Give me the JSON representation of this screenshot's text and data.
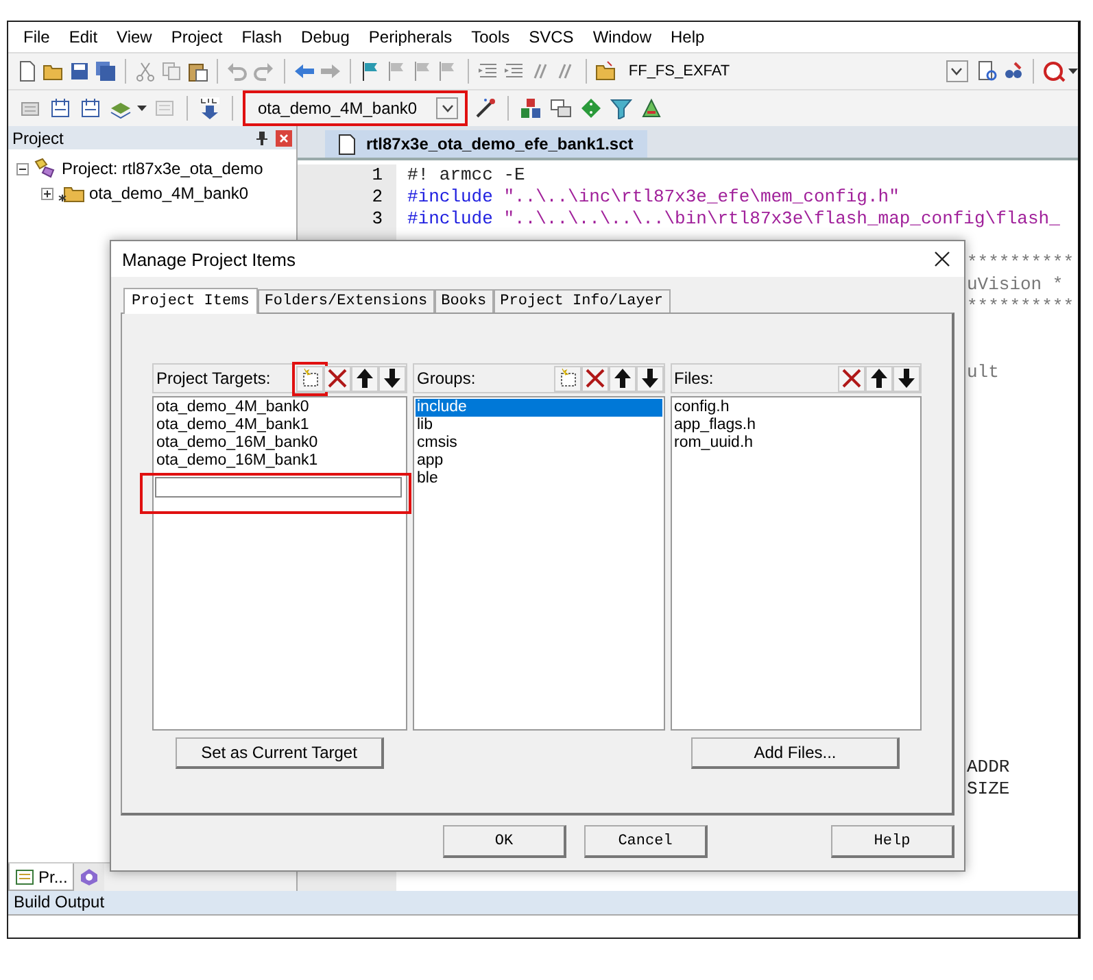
{
  "menu": [
    "File",
    "Edit",
    "View",
    "Project",
    "Flash",
    "Debug",
    "Peripherals",
    "Tools",
    "SVCS",
    "Window",
    "Help"
  ],
  "toolbar": {
    "find_combo": "FF_FS_EXFAT",
    "target_combo": {
      "value": "ota_demo_4M_bank0",
      "highlighted": true
    }
  },
  "project_panel": {
    "title": "Project",
    "tree": [
      {
        "label": "Project: rtl87x3e_ota_demo",
        "expanded": true,
        "children": [
          {
            "label": "ota_demo_4M_bank0",
            "expanded": false
          }
        ]
      }
    ],
    "tabs": [
      {
        "label": "Pr...",
        "selected": true
      },
      {
        "selected": false
      }
    ]
  },
  "editor": {
    "tab": "rtl87x3e_ota_demo_efe_bank1.sct",
    "lines": [
      {
        "kind": "full",
        "number": "1",
        "parts": [
          {
            "kind": "plain",
            "text": "#! armcc -E"
          }
        ]
      },
      {
        "kind": "full",
        "number": "2",
        "parts": [
          {
            "kind": "keyword",
            "text": "#include"
          },
          {
            "kind": "string",
            "text": " \"..\\..\\inc\\rtl87x3e_efe\\mem_config.h\""
          }
        ]
      },
      {
        "kind": "full",
        "number": "3",
        "parts": [
          {
            "kind": "keyword",
            "text": "#include"
          },
          {
            "kind": "string",
            "text": " \"..\\..\\..\\..\\..\\bin\\rtl87x3e\\flash_map_config\\flash_"
          }
        ]
      },
      {
        "kind": "hidden"
      },
      {
        "kind": "tail",
        "parts": [
          {
            "kind": "comment",
            "text": "**********"
          }
        ]
      },
      {
        "kind": "tail",
        "parts": [
          {
            "kind": "comment",
            "text": "uVision *"
          }
        ]
      },
      {
        "kind": "tail",
        "parts": [
          {
            "kind": "comment",
            "text": "**********"
          }
        ]
      },
      {
        "kind": "hidden"
      },
      {
        "kind": "hidden"
      },
      {
        "kind": "tail",
        "parts": [
          {
            "kind": "comment",
            "text": "ult"
          }
        ]
      },
      {
        "kind": "hidden"
      },
      {
        "kind": "hidden"
      },
      {
        "kind": "hidden"
      },
      {
        "kind": "hidden"
      },
      {
        "kind": "hidden"
      },
      {
        "kind": "hidden"
      },
      {
        "kind": "hidden"
      },
      {
        "kind": "hidden"
      },
      {
        "kind": "hidden"
      },
      {
        "kind": "hidden"
      },
      {
        "kind": "hidden"
      },
      {
        "kind": "hidden"
      },
      {
        "kind": "hidden"
      },
      {
        "kind": "hidden"
      },
      {
        "kind": "hidden"
      },
      {
        "kind": "hidden"
      },
      {
        "kind": "hidden"
      },
      {
        "kind": "tail",
        "parts": [
          {
            "kind": "plain",
            "text": "ADDR"
          }
        ]
      },
      {
        "kind": "tail",
        "parts": [
          {
            "kind": "plain",
            "text": "SIZE"
          }
        ]
      }
    ]
  },
  "build_output": {
    "title": "Build Output"
  },
  "dialog": {
    "title": "Manage Project Items",
    "tabs": [
      {
        "label": "Project Items",
        "selected": true
      },
      {
        "label": "Folders/Extensions",
        "selected": false
      },
      {
        "label": "Books",
        "selected": false
      },
      {
        "label": "Project Info/Layer",
        "selected": false
      }
    ],
    "columns": [
      {
        "title": "Project Targets:",
        "buttons": [
          {
            "kind": "new",
            "highlighted": true
          },
          {
            "kind": "delete",
            "highlighted": false
          },
          {
            "kind": "up",
            "highlighted": false
          },
          {
            "kind": "down",
            "highlighted": false
          }
        ],
        "items": [
          {
            "text": "ota_demo_4M_bank0",
            "selected": false
          },
          {
            "text": "ota_demo_4M_bank1",
            "selected": false
          },
          {
            "text": "ota_demo_16M_bank0",
            "selected": false
          },
          {
            "text": "ota_demo_16M_bank1",
            "selected": false
          }
        ],
        "new_item_field": {
          "highlighted": true
        },
        "action": "Set as Current Target"
      },
      {
        "title": "Groups:",
        "buttons": [
          {
            "kind": "new",
            "highlighted": false
          },
          {
            "kind": "delete",
            "highlighted": false
          },
          {
            "kind": "up",
            "highlighted": false
          },
          {
            "kind": "down",
            "highlighted": false
          }
        ],
        "items": [
          {
            "text": "include",
            "selected": true
          },
          {
            "text": "lib",
            "selected": false
          },
          {
            "text": "cmsis",
            "selected": false
          },
          {
            "text": "app",
            "selected": false
          },
          {
            "text": "ble",
            "selected": false
          }
        ]
      },
      {
        "title": "Files:",
        "buttons": [
          {
            "kind": "delete",
            "highlighted": false
          },
          {
            "kind": "up",
            "highlighted": false
          },
          {
            "kind": "down",
            "highlighted": false
          }
        ],
        "items": [
          {
            "text": "config.h",
            "selected": false
          },
          {
            "text": "app_flags.h",
            "selected": false
          },
          {
            "text": "rom_uuid.h",
            "selected": false
          }
        ],
        "action": "Add Files..."
      }
    ],
    "buttons": [
      {
        "label": "OK",
        "kind": "ok"
      },
      {
        "label": "Cancel",
        "kind": "cancel"
      },
      {
        "label": "Help",
        "kind": "help"
      }
    ]
  }
}
